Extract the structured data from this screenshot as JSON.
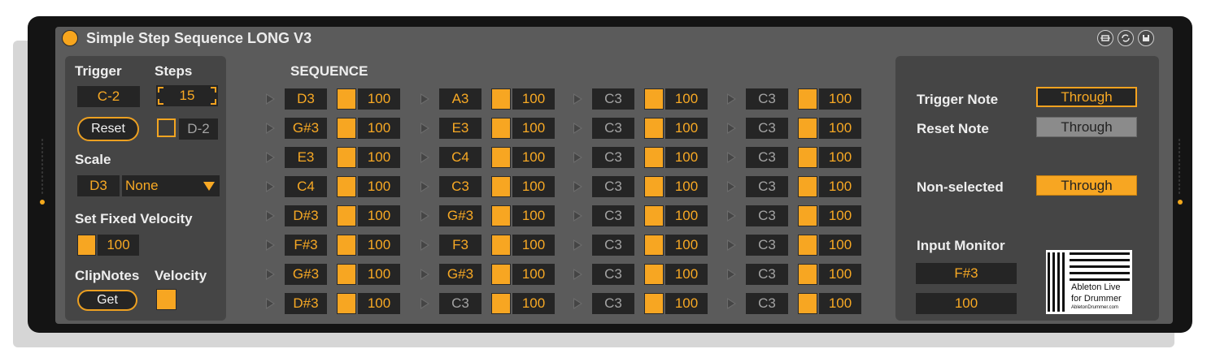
{
  "title": "Simple Step Sequence LONG V3",
  "left": {
    "trigger_label": "Trigger",
    "steps_label": "Steps",
    "trigger_value": "C-2",
    "steps_value": "15",
    "reset_label": "Reset",
    "reset_note": "D-2",
    "scale_label": "Scale",
    "scale_root": "D3",
    "scale_type": "None",
    "fixed_velocity_label": "Set Fixed Velocity",
    "fixed_velocity_value": "100",
    "clipnotes_label": "ClipNotes",
    "velocity_label": "Velocity",
    "get_label": "Get"
  },
  "sequence": {
    "label": "SEQUENCE",
    "columns": [
      {
        "steps": [
          {
            "note": "D3",
            "velocity": "100",
            "active": true
          },
          {
            "note": "G#3",
            "velocity": "100",
            "active": true
          },
          {
            "note": "E3",
            "velocity": "100",
            "active": true
          },
          {
            "note": "C4",
            "velocity": "100",
            "active": true
          },
          {
            "note": "D#3",
            "velocity": "100",
            "active": true
          },
          {
            "note": "F#3",
            "velocity": "100",
            "active": true
          },
          {
            "note": "G#3",
            "velocity": "100",
            "active": true
          },
          {
            "note": "D#3",
            "velocity": "100",
            "active": true
          }
        ]
      },
      {
        "steps": [
          {
            "note": "A3",
            "velocity": "100",
            "active": true
          },
          {
            "note": "E3",
            "velocity": "100",
            "active": true
          },
          {
            "note": "C4",
            "velocity": "100",
            "active": true
          },
          {
            "note": "C3",
            "velocity": "100",
            "active": true
          },
          {
            "note": "G#3",
            "velocity": "100",
            "active": true
          },
          {
            "note": "F3",
            "velocity": "100",
            "active": true
          },
          {
            "note": "G#3",
            "velocity": "100",
            "active": true
          },
          {
            "note": "C3",
            "velocity": "100",
            "active": false
          }
        ]
      },
      {
        "steps": [
          {
            "note": "C3",
            "velocity": "100",
            "active": false
          },
          {
            "note": "C3",
            "velocity": "100",
            "active": false
          },
          {
            "note": "C3",
            "velocity": "100",
            "active": false
          },
          {
            "note": "C3",
            "velocity": "100",
            "active": false
          },
          {
            "note": "C3",
            "velocity": "100",
            "active": false
          },
          {
            "note": "C3",
            "velocity": "100",
            "active": false
          },
          {
            "note": "C3",
            "velocity": "100",
            "active": false
          },
          {
            "note": "C3",
            "velocity": "100",
            "active": false
          }
        ]
      },
      {
        "steps": [
          {
            "note": "C3",
            "velocity": "100",
            "active": false
          },
          {
            "note": "C3",
            "velocity": "100",
            "active": false
          },
          {
            "note": "C3",
            "velocity": "100",
            "active": false
          },
          {
            "note": "C3",
            "velocity": "100",
            "active": false
          },
          {
            "note": "C3",
            "velocity": "100",
            "active": false
          },
          {
            "note": "C3",
            "velocity": "100",
            "active": false
          },
          {
            "note": "C3",
            "velocity": "100",
            "active": false
          },
          {
            "note": "C3",
            "velocity": "100",
            "active": false
          }
        ]
      }
    ]
  },
  "right": {
    "trigger_note_label": "Trigger Note",
    "trigger_note_value": "Through",
    "reset_note_label": "Reset Note",
    "reset_note_value": "Through",
    "non_selected_label": "Non-selected",
    "non_selected_value": "Through",
    "input_monitor_label": "Input Monitor",
    "input_monitor_note": "F#3",
    "input_monitor_velocity": "100"
  },
  "logo": {
    "line1": "Ableton Live",
    "line2": "for Drummer",
    "line3": "AbletonDrummer.com"
  },
  "icons": {
    "power": "power-toggle-icon",
    "title_buttons": [
      "pin-icon",
      "sync-icon",
      "save-icon"
    ]
  },
  "colors": {
    "accent": "#f7a622",
    "device_bg": "#5b5b5b",
    "panel_bg": "#454545",
    "field_bg": "#252525"
  }
}
